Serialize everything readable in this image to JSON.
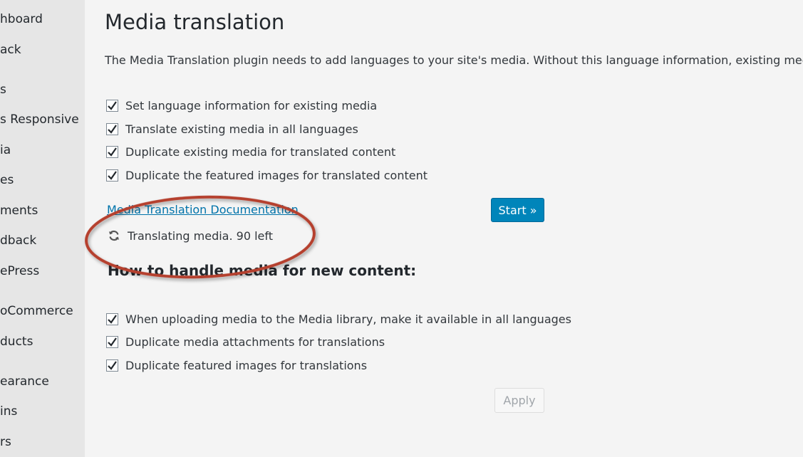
{
  "sidebar": {
    "items": [
      {
        "label": "hboard"
      },
      {
        "label": "ack"
      },
      {
        "label": "s"
      },
      {
        "label": "s Responsive"
      },
      {
        "label": "ia"
      },
      {
        "label": "es"
      },
      {
        "label": "ments"
      },
      {
        "label": "dback"
      },
      {
        "label": "ePress"
      },
      {
        "label": "oCommerce"
      },
      {
        "label": "ducts"
      },
      {
        "label": "earance"
      },
      {
        "label": "ins"
      },
      {
        "label": "rs"
      }
    ]
  },
  "main": {
    "title": "Media translation",
    "intro": "The Media Translation plugin needs to add languages to your site's media. Without this language information, existing media files",
    "existing_options": [
      {
        "label": "Set language information for existing media",
        "checked": true
      },
      {
        "label": "Translate existing media in all languages",
        "checked": true
      },
      {
        "label": "Duplicate existing media for translated content",
        "checked": true
      },
      {
        "label": "Duplicate the featured images for translated content",
        "checked": true
      }
    ],
    "doc_link": "Media Translation Documentation",
    "start_button": "Start »",
    "status_text": "Translating media. 90 left",
    "new_content_title": "How to handle media for new content:",
    "new_content_options": [
      {
        "label": "When uploading media to the Media library, make it available in all languages",
        "checked": true
      },
      {
        "label": "Duplicate media attachments for translations",
        "checked": true
      },
      {
        "label": "Duplicate featured images for translations",
        "checked": true
      }
    ],
    "apply_button": "Apply"
  },
  "colors": {
    "accent": "#0085ba",
    "link": "#0073aa",
    "annotation": "#b5402f"
  }
}
